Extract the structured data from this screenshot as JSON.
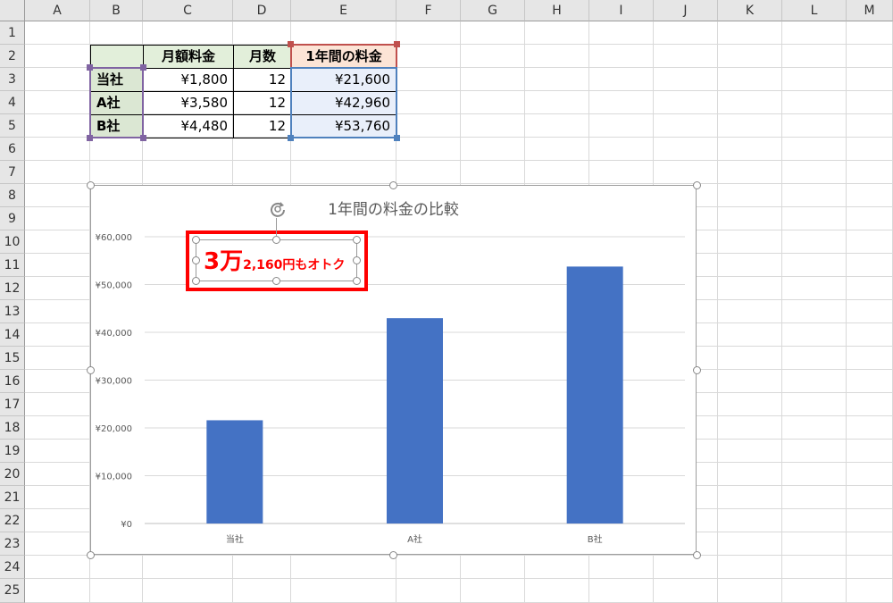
{
  "columns": [
    "A",
    "B",
    "C",
    "D",
    "E",
    "F",
    "G",
    "H",
    "I",
    "J",
    "K",
    "L",
    "M"
  ],
  "rows": [
    "1",
    "2",
    "3",
    "4",
    "5",
    "6",
    "7",
    "8",
    "9",
    "10",
    "11",
    "12",
    "13",
    "14",
    "15",
    "16",
    "17",
    "18",
    "19",
    "20",
    "21",
    "22",
    "23",
    "24",
    "25"
  ],
  "table": {
    "headers": [
      "",
      "月額料金",
      "月数",
      "1年間の料金"
    ],
    "rows": [
      {
        "label": "当社",
        "monthly": "¥1,800",
        "months": "12",
        "annual": "¥21,600"
      },
      {
        "label": "A社",
        "monthly": "¥3,580",
        "months": "12",
        "annual": "¥42,960"
      },
      {
        "label": "B社",
        "monthly": "¥4,480",
        "months": "12",
        "annual": "¥53,760"
      }
    ]
  },
  "callout": {
    "big": "3万",
    "small": "2,160円もオトク"
  },
  "colors": {
    "bar": "#4472c4",
    "callout": "#ff0000",
    "select_red": "#c0504d",
    "select_blue": "#4f81bd",
    "select_purple": "#8064a2"
  },
  "chart_data": {
    "type": "bar",
    "title": "1年間の料金の比較",
    "categories": [
      "当社",
      "A社",
      "B社"
    ],
    "values": [
      21600,
      42960,
      53760
    ],
    "ylim": [
      0,
      60000
    ],
    "yticks": [
      "¥0",
      "¥10,000",
      "¥20,000",
      "¥30,000",
      "¥40,000",
      "¥50,000",
      "¥60,000"
    ],
    "ytick_values": [
      0,
      10000,
      20000,
      30000,
      40000,
      50000,
      60000
    ],
    "grid": true,
    "legend": "none"
  }
}
